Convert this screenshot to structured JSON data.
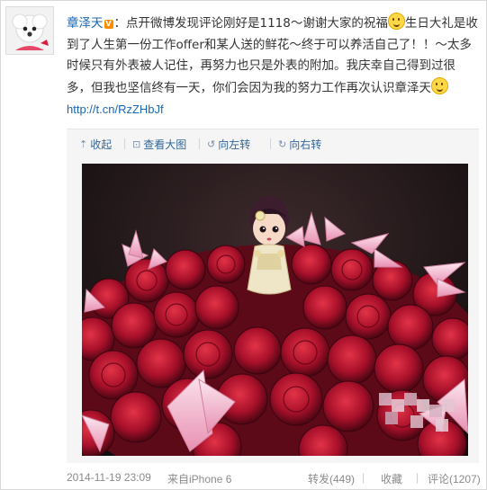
{
  "post": {
    "username": "章泽天",
    "verified_badge": "V",
    "text_1": "：点开微博发现评论刚好是1118～谢谢大家的祝福",
    "emoji_1": "shy-smile-emoji",
    "text_2": "生日大礼是收到了人生第一份工作offer和某人送的鲜花～终于可以养活自己了！！～太多时候只有外表被人记住，再努力也只是外表的附加。我庆幸自己得到过很多，但我也坚信终有一天，你们会因为我的努力工作再次认识章泽天",
    "emoji_2": "smile-emoji",
    "link": "http://t.cn/RzZHbJf"
  },
  "toolbar": {
    "collapse": "收起",
    "view_large": "查看大图",
    "rotate_left": "向左转",
    "rotate_right": "向右转"
  },
  "footer": {
    "timestamp": "2014-11-19 23:09",
    "source": "来自iPhone 6",
    "repost": "转发(449)",
    "favorite": "收藏",
    "comment": "评论(1207)"
  },
  "colors": {
    "link_blue": "#1a66b3",
    "rose_red": "#b0102a",
    "photo_background": "#1a1416",
    "muted_gray": "#8a8a8a"
  }
}
